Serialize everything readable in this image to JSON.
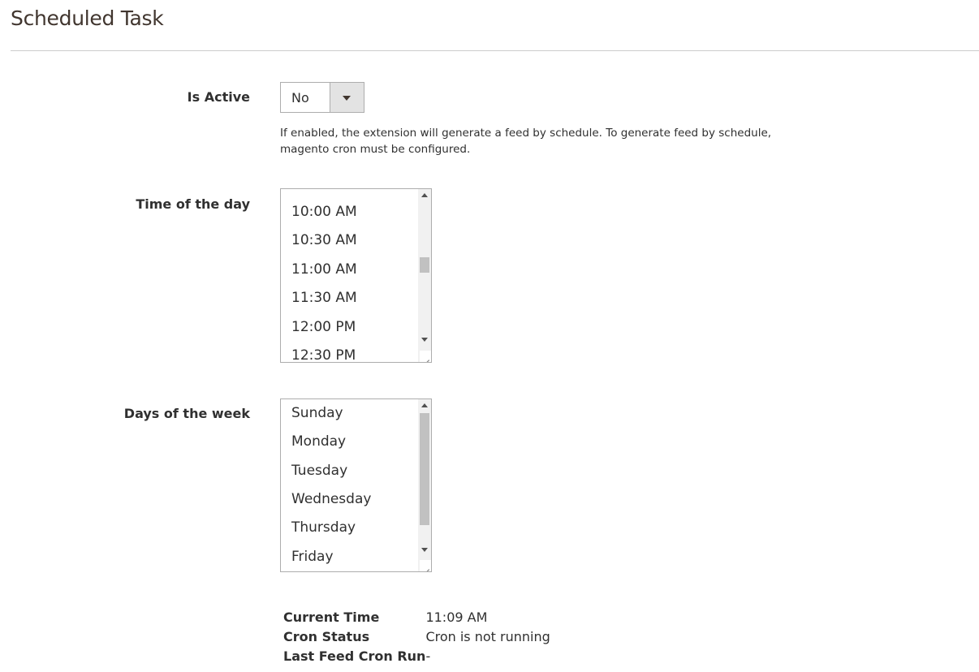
{
  "section": {
    "title": "Scheduled Task"
  },
  "is_active": {
    "label": "Is Active",
    "value": "No",
    "note": "If enabled, the extension will generate a feed by schedule. To generate feed by schedule, magento cron must be configured."
  },
  "time_of_day": {
    "label": "Time of the day",
    "options": [
      "10:00 AM",
      "10:30 AM",
      "11:00 AM",
      "11:30 AM",
      "12:00 PM",
      "12:30 PM"
    ]
  },
  "days_of_week": {
    "label": "Days of the week",
    "options": [
      "Sunday",
      "Monday",
      "Tuesday",
      "Wednesday",
      "Thursday",
      "Friday"
    ]
  },
  "status": {
    "current_time_label": "Current Time",
    "current_time_value": "11:09 AM",
    "cron_status_label": "Cron Status",
    "cron_status_value": "Cron is not running",
    "last_run_label": "Last Feed Cron Run",
    "last_run_value": "-"
  },
  "colors": {
    "select_arrow_bg": "#e3e3e3",
    "border": "#adadad",
    "text": "#303030"
  }
}
